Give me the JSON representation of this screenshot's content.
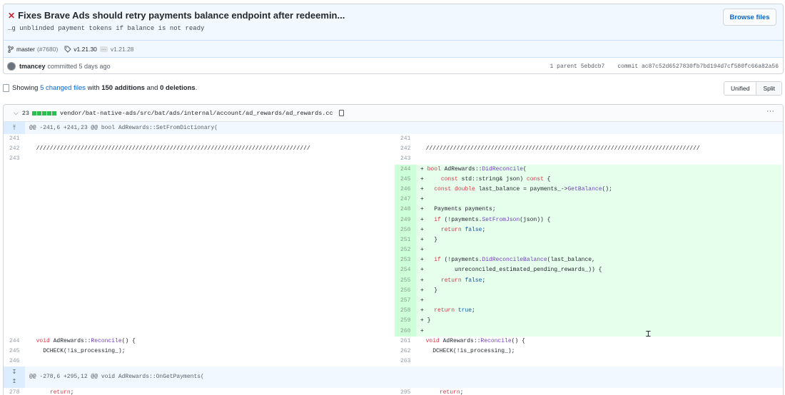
{
  "commit": {
    "status_icon": "x-icon",
    "title": "Fixes Brave Ads should retry payments balance endpoint after redeemin...",
    "description": "…g unblinded payment tokens if balance is not ready",
    "browse_files": "Browse files",
    "branch": "master",
    "pr": "(#7680)",
    "tag_main": "v1.21.30",
    "tag_more": "…",
    "tag_end": "v1.21.28",
    "author": "tmancey",
    "action": "committed 5 days ago",
    "parent": "1 parent 5ebdcb7",
    "commit_id": "commit ac87c52d6527830fb7bd194d7cf580fc66a82a56"
  },
  "summary": {
    "prefix": "Showing ",
    "changed": "5 changed files",
    "mid": " with ",
    "additions": "150 additions",
    "and": " and ",
    "deletions": "0 deletions",
    "end": ".",
    "view_unified": "Unified",
    "view_split": "Split"
  },
  "file": {
    "stat": "23",
    "path": "vendor/bat-native-ads/src/bat/ads/internal/account/ad_rewards/ad_rewards.cc",
    "more": "···"
  },
  "hunks": {
    "h1": "@@ -241,6 +241,23 @@ bool AdRewards::SetFromDictionary(",
    "h2": "@@ -278,6 +295,12 @@ void AdRewards::OnGetPayments("
  },
  "ctx1": [
    {
      "ln": "241",
      "lc": "",
      "rn": "241",
      "rc": ""
    },
    {
      "ln": "242",
      "lc": "  ////////////////////////////////////////////////////////////////////////////////",
      "rn": "242",
      "rc": "  ////////////////////////////////////////////////////////////////////////////////"
    },
    {
      "ln": "243",
      "lc": "",
      "rn": "243",
      "rc": ""
    }
  ],
  "added": [
    {
      "n": "244",
      "s": "+",
      "c": " bool AdRewards::DidReconcile("
    },
    {
      "n": "245",
      "s": "+",
      "c": "     const std::string& json) const {"
    },
    {
      "n": "246",
      "s": "+",
      "c": "   const double last_balance = payments_->GetBalance();"
    },
    {
      "n": "247",
      "s": "+",
      "c": ""
    },
    {
      "n": "248",
      "s": "+",
      "c": "   Payments payments;"
    },
    {
      "n": "249",
      "s": "+",
      "c": "   if (!payments.SetFromJson(json)) {"
    },
    {
      "n": "250",
      "s": "+",
      "c": "     return false;"
    },
    {
      "n": "251",
      "s": "+",
      "c": "   }"
    },
    {
      "n": "252",
      "s": "+",
      "c": ""
    },
    {
      "n": "253",
      "s": "+",
      "c": "   if (!payments.DidReconcileBalance(last_balance,"
    },
    {
      "n": "254",
      "s": "+",
      "c": "         unreconciled_estimated_pending_rewards_)) {"
    },
    {
      "n": "255",
      "s": "+",
      "c": "     return false;"
    },
    {
      "n": "256",
      "s": "+",
      "c": "   }"
    },
    {
      "n": "257",
      "s": "+",
      "c": ""
    },
    {
      "n": "258",
      "s": "+",
      "c": "   return true;"
    },
    {
      "n": "259",
      "s": "+",
      "c": " }"
    },
    {
      "n": "260",
      "s": "+",
      "c": ""
    }
  ],
  "ctx2": [
    {
      "ln": "244",
      "lc": "  void AdRewards::Reconcile() {",
      "rn": "261",
      "rc": "  void AdRewards::Reconcile() {"
    },
    {
      "ln": "245",
      "lc": "    DCHECK(!is_processing_);",
      "rn": "262",
      "rc": "    DCHECK(!is_processing_);"
    },
    {
      "ln": "246",
      "lc": "",
      "rn": "263",
      "rc": ""
    }
  ],
  "ctx3": [
    {
      "ln": "278",
      "lc": "      return;",
      "rn": "295",
      "rc": "      return;"
    }
  ]
}
